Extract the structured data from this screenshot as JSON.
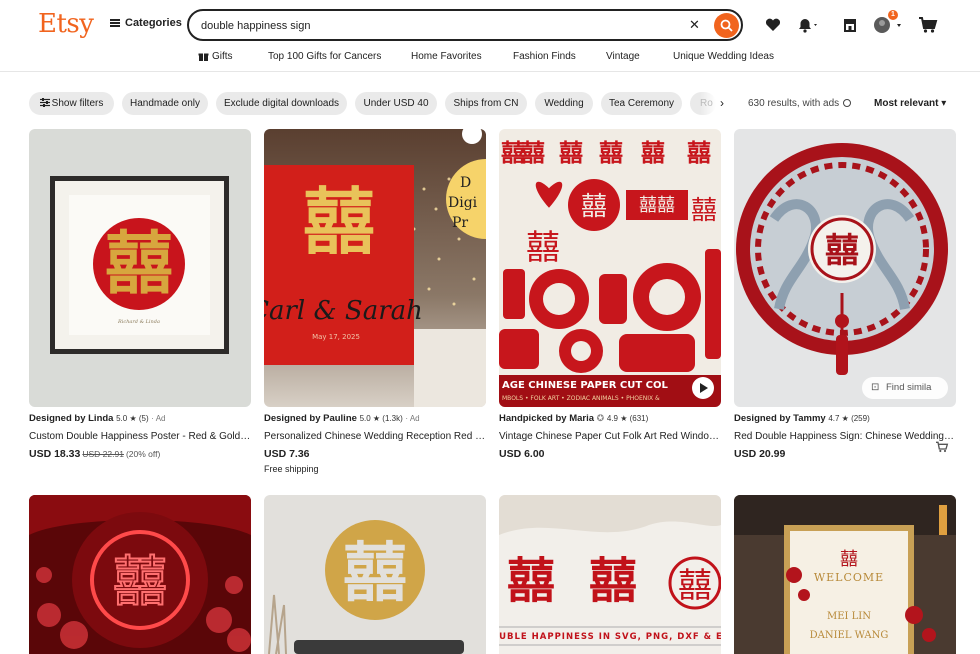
{
  "header": {
    "logo": "Etsy",
    "categories_label": "Categories",
    "search_value": "double happiness sign",
    "notification_count": "1"
  },
  "subnav": [
    "Gifts",
    "Top 100 Gifts for Cancers",
    "Home Favorites",
    "Fashion Finds",
    "Vintage",
    "Unique Wedding Ideas"
  ],
  "filters": {
    "show_filters": "Show filters",
    "chips": [
      "Handmade only",
      "Exclude digital downloads",
      "Under USD 40",
      "Ships from CN",
      "Wedding",
      "Tea Ceremony",
      "Ro"
    ],
    "results": "630 results, with ads",
    "sort": "Most relevant"
  },
  "listings": [
    {
      "designer": "Designed by Linda",
      "rating": "5.0 ★ (5)",
      "ad": "· Ad",
      "title": "Custom Double Happiness Poster - Red & Gold C...",
      "price": "USD 18.33",
      "orig": "USD 22.91",
      "disc": "(20% off)",
      "ship": ""
    },
    {
      "designer": "Designed by Pauline",
      "rating": "5.0 ★ (1.3k)",
      "ad": "· Ad",
      "title": "Personalized Chinese Wedding Reception Red & ...",
      "price": "USD 7.36",
      "orig": "",
      "disc": "",
      "ship": "Free shipping"
    },
    {
      "designer": "Handpicked by Maria",
      "rating": "4.9 ★ (631)",
      "ad": "",
      "title": "Vintage Chinese Paper Cut Folk Art Red Window ...",
      "price": "USD 6.00",
      "orig": "",
      "disc": "",
      "ship": ""
    },
    {
      "designer": "Designed by Tammy",
      "rating": "4.7 ★ (259)",
      "ad": "",
      "title": "Red Double Happiness Sign: Chinese Wedding W...",
      "price": "USD 20.99",
      "orig": "",
      "disc": "",
      "ship": ""
    }
  ],
  "image_text": {
    "card2_names": "Carl & Sarah",
    "card2_badge": "D Digi Pr",
    "card3_banner": "AGE CHINESE PAPER CUT COL",
    "card3_sub": "MBOLS • FOLK ART • ZODIAC ANIMALS • PHOENIX &",
    "card4_find": "Find simila",
    "card7_banner": "DOUBLE HAPPINESS IN SVG, PNG, DXF & EPS",
    "card8_welcome": "WELCOME",
    "card8_name1": "MEI LIN",
    "card8_name2": "DANIEL WANG"
  },
  "colors": {
    "brand": "#f1641e",
    "red": "#c41e24",
    "gold": "#d4a64a"
  }
}
